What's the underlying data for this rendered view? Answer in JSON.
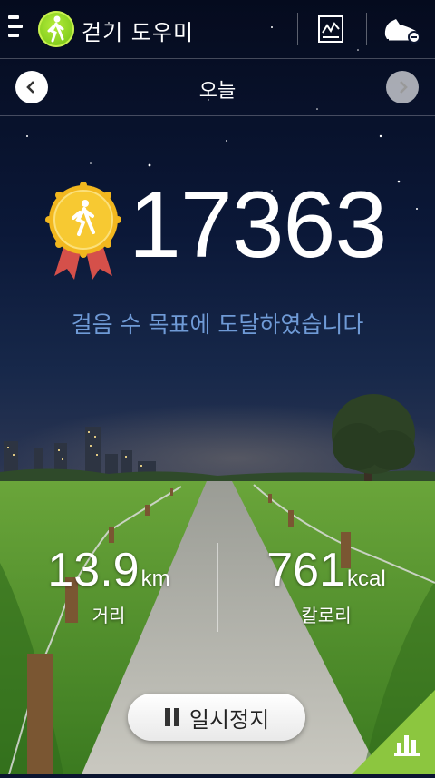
{
  "header": {
    "app_title": "걷기 도우미",
    "icons": [
      "menu-icon",
      "walker-logo-icon",
      "chart-icon",
      "shoe-icon"
    ]
  },
  "date_nav": {
    "label": "오늘",
    "prev_icon": "chevron-left-icon",
    "next_icon": "chevron-right-icon"
  },
  "steps": {
    "count": "17363",
    "goal_message": "걸음 수 목표에 도달하였습니다",
    "badge_icon": "gold-medal-icon"
  },
  "stats": {
    "distance": {
      "value": "13.9",
      "unit": "km",
      "label": "거리"
    },
    "calories": {
      "value": "761",
      "unit": "kcal",
      "label": "칼로리"
    }
  },
  "controls": {
    "pause_label": "일시정지",
    "stats_icon": "bar-chart-icon"
  },
  "colors": {
    "accent_green": "#8cc63f",
    "goal_text": "#6f9ad6",
    "sky_top": "#050b1e"
  }
}
